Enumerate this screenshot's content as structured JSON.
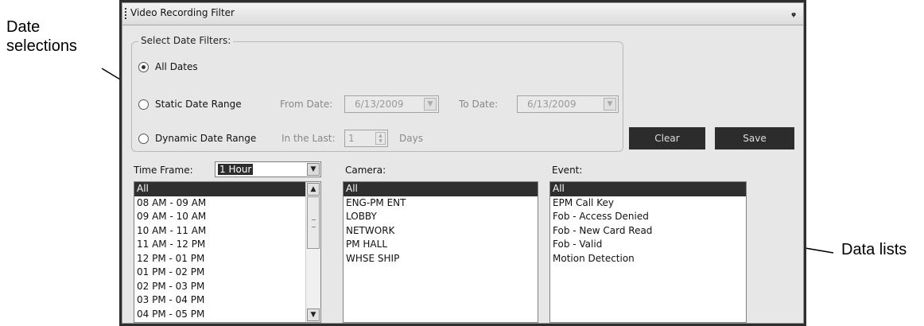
{
  "callouts": {
    "left_line1": "Date",
    "left_line2": "selections",
    "right": "Data lists"
  },
  "window": {
    "title": "Video Recording Filter",
    "pin_icon": "pin-icon"
  },
  "date_filters": {
    "legend": "Select Date Filters:",
    "selected": "All Dates",
    "all_dates_label": "All Dates",
    "static_label": "Static Date Range",
    "from_date_label": "From Date:",
    "from_date_value": "6/13/2009",
    "to_date_label": "To Date:",
    "to_date_value": "6/13/2009",
    "dynamic_label": "Dynamic Date Range",
    "in_the_last_label": "In the Last:",
    "in_the_last_value": "1",
    "days_label": "Days"
  },
  "buttons": {
    "clear": "Clear",
    "save": "Save"
  },
  "time_frame": {
    "label": "Time Frame:",
    "selected": "1 Hour",
    "items": [
      "All",
      "08 AM - 09 AM",
      "09 AM - 10 AM",
      "10 AM - 11 AM",
      "11 AM - 12 PM",
      "12 PM - 01 PM",
      "01 PM - 02 PM",
      "02 PM - 03 PM",
      "03 PM - 04 PM",
      "04 PM - 05 PM"
    ],
    "selected_item": "All"
  },
  "camera": {
    "label": "Camera:",
    "items": [
      "All",
      "ENG-PM ENT",
      "LOBBY",
      "NETWORK",
      "PM HALL",
      "WHSE SHIP"
    ],
    "selected_item": "All"
  },
  "event": {
    "label": "Event:",
    "items": [
      "All",
      "EPM Call Key",
      "Fob - Access Denied",
      "Fob - New Card Read",
      "Fob - Valid",
      "Motion Detection"
    ],
    "selected_item": "All"
  },
  "colors": {
    "panel_background": "#e7e7e7",
    "selection": "#2f2f2f",
    "button": "#2c2c2c"
  }
}
